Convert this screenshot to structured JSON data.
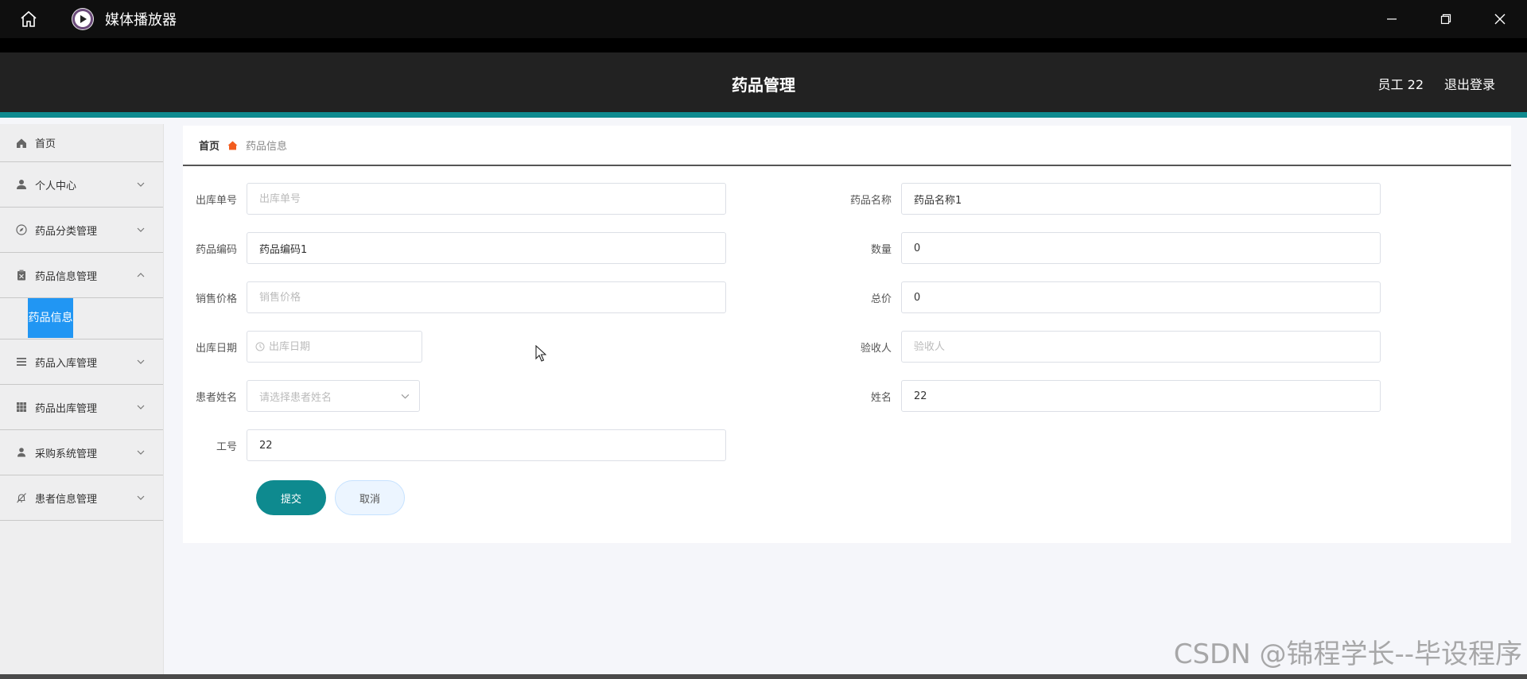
{
  "window": {
    "title": "媒体播放器"
  },
  "header": {
    "title": "药品管理",
    "user": "员工 22",
    "logout": "退出登录"
  },
  "sidebar": {
    "home": "首页",
    "items": [
      {
        "label": "个人中心",
        "icon": "user-icon",
        "expanded": false
      },
      {
        "label": "药品分类管理",
        "icon": "compass-icon",
        "expanded": false
      },
      {
        "label": "药品信息管理",
        "icon": "clipboard-icon",
        "expanded": true
      },
      {
        "label": "药品入库管理",
        "icon": "list-icon",
        "expanded": false
      },
      {
        "label": "药品出库管理",
        "icon": "grid-icon",
        "expanded": false
      },
      {
        "label": "采购系统管理",
        "icon": "person-icon",
        "expanded": false
      },
      {
        "label": "患者信息管理",
        "icon": "bell-off-icon",
        "expanded": false
      }
    ],
    "active_sub": "药品信息"
  },
  "breadcrumb": {
    "home": "首页",
    "current": "药品信息"
  },
  "form": {
    "outbound_no": {
      "label": "出库单号",
      "value": "",
      "placeholder": "出库单号"
    },
    "drug_name": {
      "label": "药品名称",
      "value": "药品名称1"
    },
    "drug_code": {
      "label": "药品编码",
      "value": "药品编码1"
    },
    "quantity": {
      "label": "数量",
      "value": "0"
    },
    "sale_price": {
      "label": "销售价格",
      "value": "",
      "placeholder": "销售价格"
    },
    "total_price": {
      "label": "总价",
      "value": "0"
    },
    "outbound_date": {
      "label": "出库日期",
      "value": "",
      "placeholder": "出库日期"
    },
    "inspector": {
      "label": "验收人",
      "value": "",
      "placeholder": "验收人"
    },
    "patient_name": {
      "label": "患者姓名",
      "placeholder": "请选择患者姓名"
    },
    "name": {
      "label": "姓名",
      "value": "22"
    },
    "employee_no": {
      "label": "工号",
      "value": "22"
    },
    "submit": "提交",
    "cancel": "取消"
  },
  "watermark": "CSDN @锦程学长--毕设程序",
  "colors": {
    "accent": "#0e8a8f",
    "active_sub": "#2196f3",
    "header_bg": "#222222"
  }
}
